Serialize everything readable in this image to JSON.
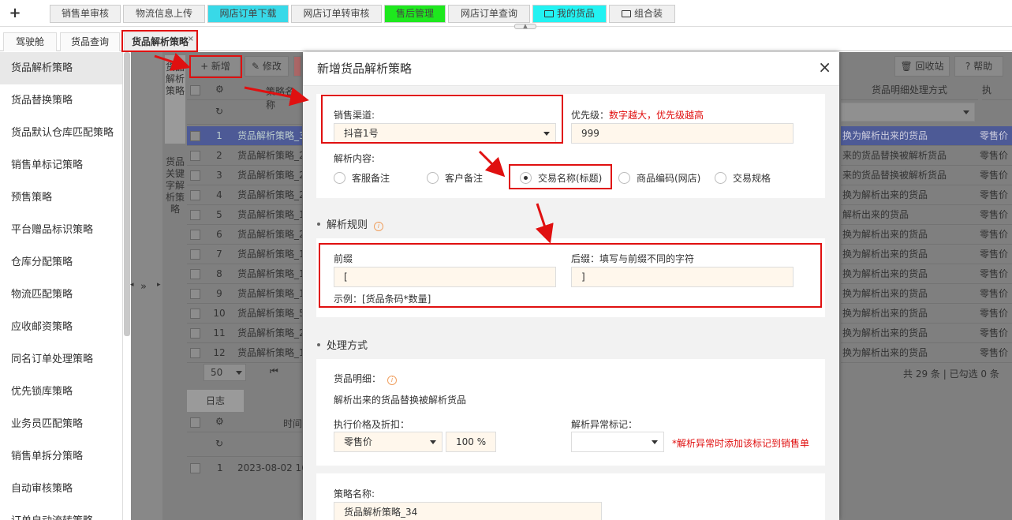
{
  "topnav": {
    "tabs": [
      {
        "label": "销售单审核",
        "color": "#f0f0f0",
        "folder": false
      },
      {
        "label": "物流信息上传",
        "color": "#f0f0f0",
        "folder": false
      },
      {
        "label": "网店订单下载",
        "color": "#38d9e8",
        "folder": false
      },
      {
        "label": "网店订单转审核",
        "color": "#f0f0f0",
        "folder": false
      },
      {
        "label": "售后管理",
        "color": "#1ee81e",
        "folder": false
      },
      {
        "label": "网店订单查询",
        "color": "#f0f0f0",
        "folder": false
      },
      {
        "label": "我的货品",
        "color": "#22f2f2",
        "folder": true
      },
      {
        "label": "组合装",
        "color": "#f0f0f0",
        "folder": true
      }
    ]
  },
  "subtabs": [
    {
      "label": "驾驶舱"
    },
    {
      "label": "货品查询"
    },
    {
      "label": "货品解析策略"
    }
  ],
  "sidebar": {
    "items": [
      "货品解析策略",
      "货品替换策略",
      "货品默认仓库匹配策略",
      "销售单标记策略",
      "预售策略",
      "平台赠品标识策略",
      "仓库分配策略",
      "物流匹配策略",
      "应收邮资策略",
      "同名订单处理策略",
      "优先锁库策略",
      "业务员匹配策略",
      "销售单拆分策略",
      "自动审核策略",
      "订单自动流转策略"
    ]
  },
  "background": {
    "vertical_tab1": "货品解析策略",
    "vertical_tab2": "货品关键字解析策略",
    "collapse_symbol": "»",
    "toolbar": {
      "add": "+ 新增",
      "edit": "修改",
      "recycle": "回收站",
      "help": "帮助"
    },
    "grid_header_name": "策略名称",
    "grid_header_detail": "货品明细处理方式",
    "grid_header_price": "执",
    "rows": [
      {
        "num": "1",
        "name": "货品解析策略_3",
        "detail": "换为解析出来的货品",
        "price": "零售价"
      },
      {
        "num": "2",
        "name": "货品解析策略_2",
        "detail": "来的货品替换被解析货品",
        "price": "零售价"
      },
      {
        "num": "3",
        "name": "货品解析策略_2",
        "detail": "来的货品替换被解析货品",
        "price": "零售价"
      },
      {
        "num": "4",
        "name": "货品解析策略_2",
        "detail": "换为解析出来的货品",
        "price": "零售价"
      },
      {
        "num": "5",
        "name": "货品解析策略_1",
        "detail": "解析出来的货品",
        "price": "零售价"
      },
      {
        "num": "6",
        "name": "货品解析策略_2",
        "detail": "换为解析出来的货品",
        "price": "零售价"
      },
      {
        "num": "7",
        "name": "货品解析策略_1",
        "detail": "换为解析出来的货品",
        "price": "零售价"
      },
      {
        "num": "8",
        "name": "货品解析策略_1",
        "detail": "换为解析出来的货品",
        "price": "零售价"
      },
      {
        "num": "9",
        "name": "货品解析策略_1",
        "detail": "换为解析出来的货品",
        "price": "零售价"
      },
      {
        "num": "10",
        "name": "货品解析策略_5",
        "detail": "换为解析出来的货品",
        "price": "零售价"
      },
      {
        "num": "11",
        "name": "货品解析策略_2",
        "detail": "换为解析出来的货品",
        "price": "零售价"
      },
      {
        "num": "12",
        "name": "货品解析策略_1",
        "detail": "换为解析出来的货品",
        "price": "零售价"
      }
    ],
    "pager_size": "50",
    "total": "共 29 条 | 已勾选 0 条",
    "log_tab": "日志",
    "log_header_time": "时间",
    "log_row_num": "1",
    "log_row_time": "2023-08-02 16"
  },
  "dialog": {
    "title": "新增货品解析策略",
    "close": "×",
    "channel_label": "销售渠道:",
    "channel_value": "抖音1号",
    "priority_label": "优先级：",
    "priority_hint": "数字越大，优先级越高",
    "priority_value": "999",
    "content_label": "解析内容:",
    "content_options": [
      {
        "label": "客服备注",
        "checked": false
      },
      {
        "label": "客户备注",
        "checked": false
      },
      {
        "label": "交易名称(标题)",
        "checked": true
      },
      {
        "label": "商品编码(网店)",
        "checked": false
      },
      {
        "label": "交易规格",
        "checked": false
      }
    ],
    "rules_title": "解析规则",
    "prefix_label": "前缀",
    "prefix_value": "[",
    "suffix_label": "后缀：填写与前缀不同的字符",
    "suffix_value": "]",
    "example": "示例：[货品条码*数量]",
    "process_title": "处理方式",
    "detail_label": "货品明细：",
    "detail_value": "解析出来的货品替换被解析货品",
    "price_label": "执行价格及折扣：",
    "price_value": "零售价",
    "discount_value": "100 %",
    "abnormal_label": "解析异常标记：",
    "abnormal_value": "",
    "abnormal_hint": "*解析异常时添加该标记到销售单",
    "name_label": "策略名称:",
    "name_value": "货品解析策略_34"
  }
}
